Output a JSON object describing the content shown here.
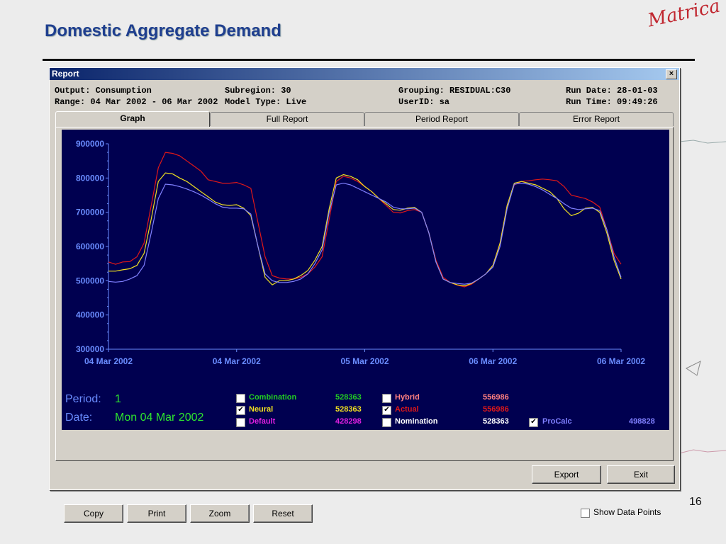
{
  "slide": {
    "title": "Domestic Aggregate Demand",
    "logo": "Matrica",
    "page_number": "16"
  },
  "window": {
    "title": "Report",
    "close_label": "×"
  },
  "info": {
    "output": "Output: Consumption",
    "range": "Range: 04 Mar 2002 - 06 Mar 2002",
    "subregion": "Subregion: 30",
    "model_type": "Model Type: Live",
    "grouping": "Grouping: RESIDUAL:C30",
    "userid": "UserID: sa",
    "run_date": "Run Date: 28-01-03",
    "run_time": "Run Time: 09:49:26"
  },
  "tabs": [
    {
      "label": "Graph",
      "active": true
    },
    {
      "label": "Full Report",
      "active": false
    },
    {
      "label": "Period Report",
      "active": false
    },
    {
      "label": "Error Report",
      "active": false
    }
  ],
  "chart_data": {
    "type": "line",
    "title": "",
    "xlabel": "",
    "ylabel": "",
    "ylim": [
      300000,
      900000
    ],
    "yticks": [
      "900000",
      "800000",
      "700000",
      "600000",
      "500000",
      "400000",
      "300000"
    ],
    "xticks": [
      "04 Mar 2002",
      "04 Mar 2002",
      "05 Mar 2002",
      "06 Mar 2002",
      "06 Mar 2002"
    ],
    "background": "#000050",
    "series": [
      {
        "name": "Actual",
        "color": "#e01818",
        "values": [
          555000,
          548000,
          555000,
          556000,
          570000,
          610000,
          720000,
          830000,
          875000,
          872000,
          865000,
          850000,
          835000,
          820000,
          795000,
          790000,
          785000,
          785000,
          787000,
          780000,
          770000,
          670000,
          570000,
          515000,
          508000,
          505000,
          505000,
          510000,
          520000,
          540000,
          570000,
          680000,
          790000,
          805000,
          800000,
          790000,
          775000,
          760000,
          740000,
          720000,
          700000,
          698000,
          705000,
          708000,
          700000,
          640000,
          560000,
          510000,
          495000,
          487000,
          482000,
          490000,
          505000,
          520000,
          545000,
          610000,
          720000,
          780000,
          790000,
          792000,
          795000,
          797000,
          795000,
          792000,
          775000,
          750000,
          745000,
          740000,
          730000,
          715000,
          650000,
          580000,
          548000
        ]
      },
      {
        "name": "Neural",
        "color": "#f0e020",
        "values": [
          528000,
          528000,
          532000,
          535000,
          545000,
          580000,
          680000,
          790000,
          815000,
          812000,
          800000,
          790000,
          775000,
          760000,
          745000,
          730000,
          722000,
          720000,
          722000,
          712000,
          690000,
          600000,
          510000,
          488000,
          500000,
          500000,
          505000,
          515000,
          530000,
          560000,
          600000,
          710000,
          800000,
          810000,
          805000,
          795000,
          775000,
          760000,
          740000,
          725000,
          708000,
          706000,
          712000,
          714000,
          700000,
          640000,
          555000,
          505000,
          495000,
          488000,
          485000,
          492000,
          505000,
          520000,
          545000,
          610000,
          720000,
          785000,
          790000,
          785000,
          780000,
          770000,
          760000,
          740000,
          710000,
          690000,
          697000,
          712000,
          714000,
          700000,
          640000,
          560000,
          505000
        ]
      },
      {
        "name": "ProCalc",
        "color": "#8080ff",
        "values": [
          498000,
          496000,
          498000,
          505000,
          515000,
          545000,
          640000,
          740000,
          782000,
          780000,
          775000,
          768000,
          760000,
          750000,
          738000,
          725000,
          715000,
          712000,
          712000,
          710000,
          695000,
          600000,
          520000,
          500000,
          495000,
          495000,
          498000,
          505000,
          520000,
          550000,
          590000,
          700000,
          780000,
          785000,
          780000,
          770000,
          760000,
          750000,
          740000,
          730000,
          715000,
          710000,
          710000,
          712000,
          700000,
          640000,
          555000,
          505000,
          495000,
          492000,
          490000,
          493000,
          505000,
          520000,
          540000,
          600000,
          710000,
          782000,
          785000,
          782000,
          775000,
          765000,
          752000,
          740000,
          725000,
          712000,
          708000,
          710000,
          712000,
          705000,
          650000,
          570000,
          510000
        ]
      }
    ]
  },
  "period": {
    "period_label": "Period:",
    "period_value": "1",
    "date_label": "Date:",
    "date_value": "Mon 04 Mar 2002"
  },
  "legend": [
    {
      "label": "Combination",
      "value": "528363",
      "checked": false,
      "color": "#22cc22"
    },
    {
      "label": "Neural",
      "value": "528363",
      "checked": true,
      "color": "#f0e020"
    },
    {
      "label": "Default",
      "value": "428298",
      "checked": false,
      "color": "#e020e0"
    },
    {
      "label": "Hybrid",
      "value": "556986",
      "checked": false,
      "color": "#ff8080"
    },
    {
      "label": "Actual",
      "value": "556986",
      "checked": true,
      "color": "#e01818"
    },
    {
      "label": "Nomination",
      "value": "528363",
      "checked": false,
      "color": "#ffffff"
    },
    {
      "label": "ProCalc",
      "value": "498828",
      "checked": true,
      "color": "#8080ff"
    }
  ],
  "buttons": {
    "copy": "Copy",
    "print": "Print",
    "zoom": "Zoom",
    "reset": "Reset",
    "export": "Export",
    "exit": "Exit"
  },
  "show_data_points": {
    "label": "Show Data Points",
    "checked": false
  }
}
